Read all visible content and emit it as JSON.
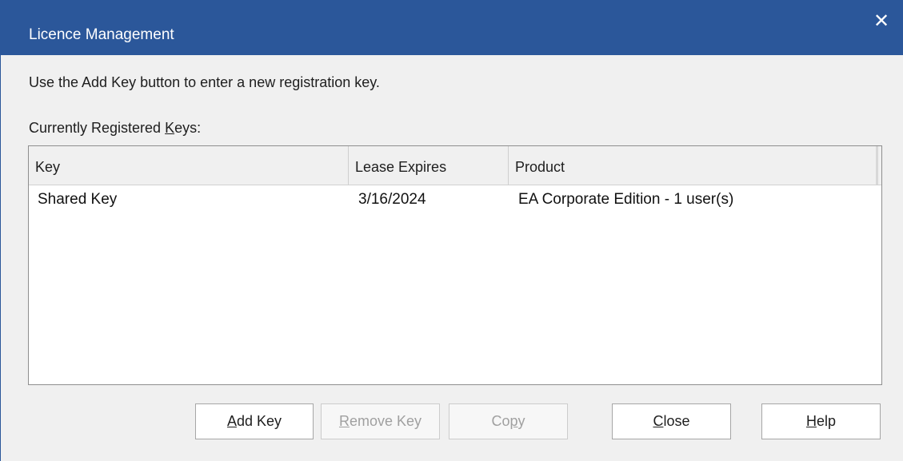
{
  "dialog": {
    "title": "Licence Management",
    "close_glyph": "✕",
    "instructions": "Use the Add Key button to enter a new registration key.",
    "keys_label": {
      "before": "Currently Registered ",
      "mnemonic": "K",
      "after": "eys:"
    }
  },
  "keys_table": {
    "columns": [
      "Key",
      "Lease Expires",
      "Product"
    ],
    "rows": [
      {
        "key": "Shared Key",
        "lease_expires": "3/16/2024",
        "product": "EA Corporate Edition - 1 user(s)"
      }
    ]
  },
  "buttons": {
    "add_key": {
      "mnemonic": "A",
      "rest": "dd Key",
      "enabled": true
    },
    "remove_key": {
      "mnemonic": "R",
      "rest": "emove Key",
      "enabled": false
    },
    "copy": {
      "before": "Co",
      "mnemonic": "p",
      "after": "y",
      "enabled": false
    },
    "close": {
      "mnemonic": "C",
      "rest": "lose",
      "enabled": true
    },
    "help": {
      "mnemonic": "H",
      "rest": "elp",
      "enabled": true
    }
  },
  "colors": {
    "titlebar": "#2b579a",
    "dialog_background": "#f0f0f0"
  }
}
